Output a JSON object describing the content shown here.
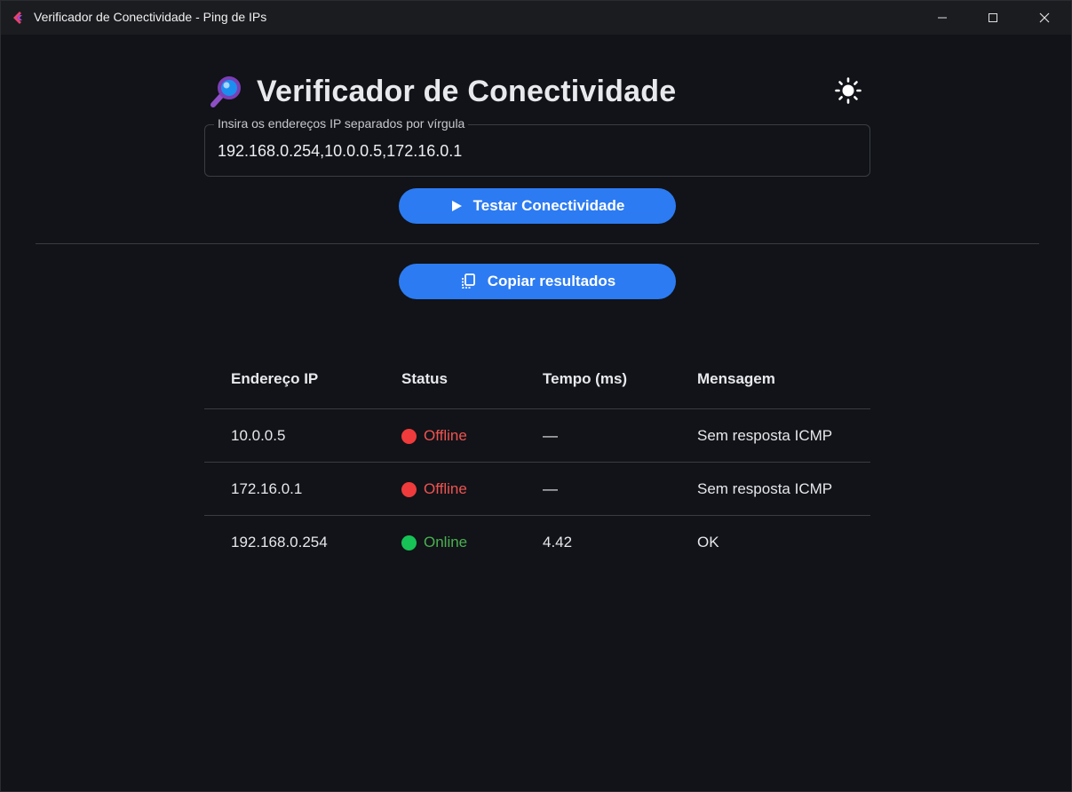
{
  "window": {
    "title": "Verificador de Conectividade - Ping de IPs",
    "controls": [
      "minimize",
      "maximize",
      "close"
    ]
  },
  "header": {
    "icon": "magnifier-icon",
    "title": "Verificador de Conectividade",
    "theme_toggle_icon": "sun-icon"
  },
  "input": {
    "label": "Insira os endereços IP separados por vírgula",
    "value": "192.168.0.254,10.0.0.5,172.16.0.1"
  },
  "buttons": {
    "test_label": "Testar Conectividade",
    "test_icon": "play-icon",
    "copy_label": "Copiar resultados",
    "copy_icon": "copy-icon"
  },
  "table": {
    "headers": [
      "Endereço IP",
      "Status",
      "Tempo (ms)",
      "Mensagem"
    ],
    "rows": [
      {
        "ip": "10.0.0.5",
        "status": "Offline",
        "time": "—",
        "message": "Sem resposta ICMP"
      },
      {
        "ip": "172.16.0.1",
        "status": "Offline",
        "time": "—",
        "message": "Sem resposta ICMP"
      },
      {
        "ip": "192.168.0.254",
        "status": "Online",
        "time": "4.42",
        "message": "OK"
      }
    ]
  },
  "colors": {
    "background": "#111318",
    "accent": "#2c7bf2",
    "offline": "#ef3b3b",
    "online": "#17c256"
  }
}
